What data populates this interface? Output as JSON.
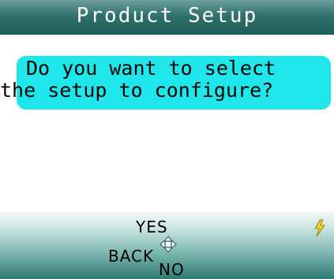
{
  "header": {
    "title": "Product Setup"
  },
  "prompt": {
    "line1": "Do you want to select",
    "line2": "the setup to configure?"
  },
  "softkeys": {
    "yes": "YES",
    "back": "BACK",
    "no": "NO"
  },
  "icons": {
    "navigation": "four-way-arrow-icon",
    "power": "lightning-bolt-icon"
  },
  "colors": {
    "title_bar": "#2f706d",
    "prompt_bg": "#1ee6ea",
    "title_text": "#ffffff",
    "power_icon": "#f2d22a"
  }
}
